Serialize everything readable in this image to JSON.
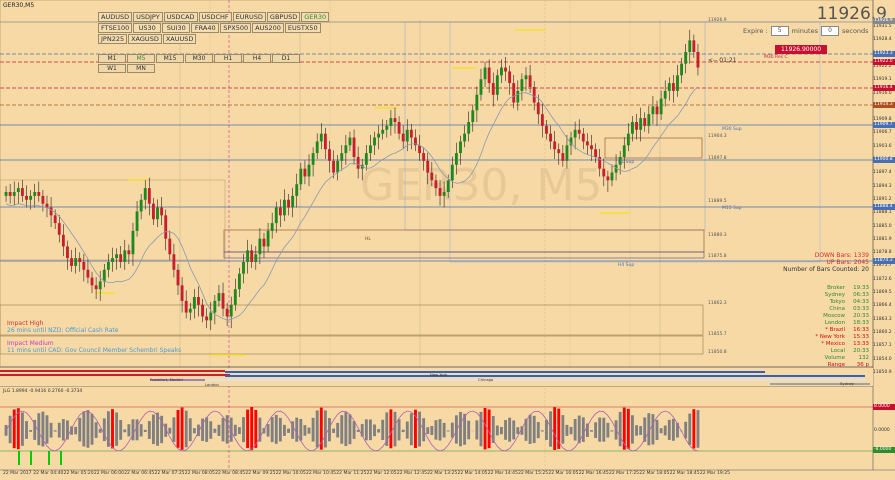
{
  "window": {
    "title": "GER30,M5"
  },
  "watermark": "GER30, M5",
  "symbols": {
    "row1": [
      "AUDUSD",
      "USDJPY",
      "USDCAD",
      "USDCHF",
      "EURUSD",
      "GBPUSD",
      "GER30"
    ],
    "row2": [
      "FTSE100",
      "US30",
      "SUI30",
      "FRA40",
      "SPX500",
      "AUS200",
      "EUSTX50"
    ],
    "row3": [
      "JPN225",
      "XAGUSD",
      "XAUUSD"
    ],
    "active": "GER30"
  },
  "timeframes": {
    "row1": [
      "M1",
      "M5",
      "M15",
      "M30",
      "H1",
      "H4",
      "D1"
    ],
    "row2": [
      "W1",
      "MN"
    ],
    "active": "M5"
  },
  "trade_panel": {
    "price": "11926.9",
    "expire_label": "Expire :",
    "expire_value": "5",
    "minutes_label": "minutes",
    "seconds_value": "0",
    "seconds_label": "seconds",
    "button_label": "11926.90000"
  },
  "countdown": "<-- 01:21",
  "level_labels": {
    "m30_res": "M30 Res C",
    "m30_sup": "M30 Sup",
    "h1_sup": "H1 Sup",
    "m15_sup": "M15 Sup",
    "h4_sup": "H4 Sup",
    "hl": "HL"
  },
  "bars": {
    "down_label": "DOWN Bars:",
    "down_value": "1339",
    "up_label": "UP Bars:",
    "up_value": "2045",
    "count_label": "Number of Bars Counted:",
    "count_value": "20"
  },
  "timezones": [
    {
      "name": "Broker",
      "time": "19:33",
      "color": "#2e8b2e"
    },
    {
      "name": "Sydney",
      "time": "06:33",
      "color": "#2e8b2e"
    },
    {
      "name": "Tokyo",
      "time": "04:33",
      "color": "#2e8b2e"
    },
    {
      "name": "China",
      "time": "03:33",
      "color": "#2e8b2e"
    },
    {
      "name": "Moscow",
      "time": "20:33",
      "color": "#2e8b2e"
    },
    {
      "name": "London",
      "time": "18:33",
      "color": "#2e8b2e"
    },
    {
      "name": "* Brazil",
      "time": "16:33",
      "color": "#d01010"
    },
    {
      "name": "* New York",
      "time": "15:33",
      "color": "#d01010"
    },
    {
      "name": "* Mexico",
      "time": "13:33",
      "color": "#d01010"
    },
    {
      "name": "Local",
      "time": "20:33",
      "color": "#2e8b2e"
    },
    {
      "name": "Volume",
      "time": "132",
      "color": "#2e8b2e"
    },
    {
      "name": "Range",
      "time": "36 p",
      "color": "#d01010"
    }
  ],
  "news": {
    "high_label": "Impact High",
    "high_text": "26 mins until NZD: Official Cash Rate",
    "medium_label": "Impact Medium",
    "medium_text": "11 mins until CAD: Gov Council Member Schembri Speaks"
  },
  "sessions": {
    "frankfurt": "Frankfurt, Madrid",
    "london": "London",
    "newyork": "New York",
    "chicago": "Chicago",
    "sydney": "Sydney"
  },
  "indicator": {
    "label": "JLG 1.8994 -0.9416 0.2760 -0.3734",
    "upper": "8.0000",
    "lower": "-8.0000",
    "zero": "0.0000"
  },
  "price_axis": [
    "11931.5",
    "11928.4",
    "11925.3",
    "11922.2",
    "11919.1",
    "11916.0",
    "11912.9",
    "11909.8",
    "11906.7",
    "11903.6",
    "11900.5",
    "11897.4",
    "11894.3",
    "11891.2",
    "11888.1",
    "11885.0",
    "11881.9",
    "11878.8",
    "11875.7",
    "11872.6",
    "11869.5",
    "11866.4",
    "11863.3",
    "11860.2",
    "11857.1",
    "11854.0",
    "11850.9"
  ],
  "price_tags": [
    {
      "text": "11926.9",
      "color": "#888888",
      "y": 21
    },
    {
      "text": "11923.3",
      "color": "#4a6fb0",
      "y": 54
    },
    {
      "text": "11922.0",
      "color": "#c8102e",
      "y": 62
    },
    {
      "text": "11916.4",
      "color": "#c8102e",
      "y": 88
    },
    {
      "text": "11914.3",
      "color": "#b05020",
      "y": 105
    },
    {
      "text": "11909.7",
      "color": "#4a6fb0",
      "y": 125
    },
    {
      "text": "11900.8",
      "color": "#4a6fb0",
      "y": 160
    },
    {
      "text": "11888.4",
      "color": "#4a6fb0",
      "y": 207
    },
    {
      "text": "11874.3",
      "color": "#4a6fb0",
      "y": 261
    }
  ],
  "chart_levels": [
    {
      "text": "11926.9",
      "y": 22
    },
    {
      "text": "11904.3",
      "y": 138
    },
    {
      "text": "11897.8",
      "y": 160
    },
    {
      "text": "11889.5",
      "y": 203
    },
    {
      "text": "11880.3",
      "y": 237
    },
    {
      "text": "11875.8",
      "y": 258
    },
    {
      "text": "11862.3",
      "y": 305
    },
    {
      "text": "11855.7",
      "y": 336
    },
    {
      "text": "11850.8",
      "y": 354
    }
  ],
  "time_axis": [
    "22 Mar 2017",
    "22 Mar 04:40",
    "22 Mar 05:20",
    "22 Mar 06:00",
    "22 Mar 06:45",
    "22 Mar 07:25",
    "22 Mar 08:05",
    "22 Mar 08:45",
    "22 Mar 09:25",
    "22 Mar 10:05",
    "22 Mar 10:45",
    "22 Mar 11:25",
    "22 Mar 12:05",
    "22 Mar 12:45",
    "22 Mar 13:25",
    "22 Mar 14:05",
    "22 Mar 14:45",
    "22 Mar 15:25",
    "22 Mar 16:05",
    "22 Mar 16:45",
    "22 Mar 17:25",
    "22 Mar 18:05",
    "22 Mar 18:45",
    "22 Mar 19:25"
  ],
  "colors": {
    "background": "#f7d9a6",
    "bull": "#1e8a1e",
    "bear": "#c81e2e",
    "histogram": "#808080",
    "hist_up": "#ff0000",
    "hist_down": "#00cc00"
  },
  "chart_data": {
    "type": "candlestick",
    "title": "GER30,M5",
    "ylim": [
      11845,
      11935
    ],
    "closes": [
      11890,
      11889,
      11890,
      11891,
      11889,
      11888,
      11889,
      11890,
      11889,
      11887,
      11886,
      11884,
      11882,
      11879,
      11876,
      11873,
      11871,
      11873,
      11872,
      11870,
      11868,
      11866,
      11865,
      11867,
      11870,
      11872,
      11873,
      11874,
      11872,
      11875,
      11874,
      11880,
      11885,
      11888,
      11891,
      11887,
      11883,
      11886,
      11884,
      11878,
      11874,
      11870,
      11866,
      11862,
      11859,
      11860,
      11863,
      11861,
      11858,
      11857,
      11859,
      11862,
      11864,
      11860,
      11858,
      11861,
      11865,
      11869,
      11872,
      11875,
      11872,
      11874,
      11878,
      11876,
      11880,
      11882,
      11886,
      11884,
      11888,
      11886,
      11889,
      11892,
      11896,
      11894,
      11897,
      11900,
      11903,
      11905,
      11901,
      11898,
      11895,
      11898,
      11900,
      11902,
      11904,
      11899,
      11896,
      11897,
      11900,
      11902,
      11904,
      11905,
      11906,
      11907,
      11909,
      11908,
      11905,
      11903,
      11906,
      11904,
      11902,
      11900,
      11898,
      11895,
      11893,
      11891,
      11889,
      11890,
      11893,
      11897,
      11900,
      11903,
      11905,
      11908,
      11911,
      11915,
      11919,
      11922,
      11918,
      11915,
      11920,
      11922,
      11921,
      11918,
      11913,
      11916,
      11919,
      11920,
      11917,
      11913,
      11910,
      11907,
      11905,
      11903,
      11901,
      11900,
      11898,
      11902,
      11904,
      11906,
      11905,
      11903,
      11902,
      11901,
      11899,
      11896,
      11894,
      11893,
      11895,
      11897,
      11899,
      11902,
      11905,
      11908,
      11906,
      11909,
      11907,
      11910,
      11912,
      11910,
      11914,
      11916,
      11918,
      11916,
      11920,
      11923,
      11926,
      11929,
      11926,
      11922
    ]
  }
}
